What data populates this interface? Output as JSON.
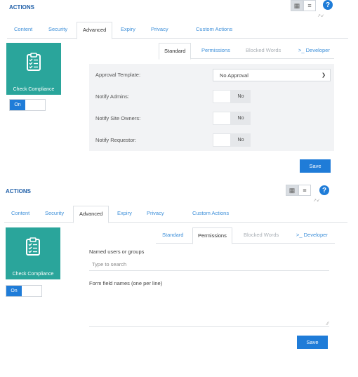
{
  "panels": [
    {
      "title": "ACTIONS",
      "top_tabs": [
        "Content",
        "Security",
        "Advanced",
        "Expiry",
        "Privacy",
        "Custom Actions"
      ],
      "active_top_tab": "Advanced",
      "compliance_label": "Check Compliance",
      "toggle_label": "On",
      "sub_tabs": [
        "Standard",
        "Permissions",
        "Blocked Words",
        ">_ Developer"
      ],
      "active_sub_tab": "Standard",
      "approval_template_label": "Approval Template:",
      "approval_template_value": "No Approval",
      "notify_admins_label": "Notify Admins:",
      "notify_admins_value": "No",
      "notify_site_owners_label": "Notify Site Owners:",
      "notify_site_owners_value": "No",
      "notify_requestor_label": "Notify Requestor:",
      "notify_requestor_value": "No",
      "save_label": "Save"
    },
    {
      "title": "ACTIONS",
      "top_tabs": [
        "Content",
        "Security",
        "Advanced",
        "Expiry",
        "Privacy",
        "Custom Actions"
      ],
      "active_top_tab": "Advanced",
      "compliance_label": "Check Compliance",
      "toggle_label": "On",
      "sub_tabs": [
        "Standard",
        "Permissions",
        "Blocked Words",
        ">_ Developer"
      ],
      "active_sub_tab": "Permissions",
      "named_users_label": "Named users or groups",
      "search_placeholder": "Type to search",
      "form_field_label": "Form field names (one per line)",
      "save_label": "Save"
    }
  ],
  "icons": {
    "grid": "grid-view-icon",
    "list": "list-view-icon",
    "help": "help-icon",
    "clipboard": "clipboard-check-icon",
    "chevron": "chevron-down-icon",
    "resize": "resize-grip-icon"
  },
  "colors": {
    "accent": "#1f7cd8",
    "title": "#1f5fa8",
    "tab_link": "#3d8fd9",
    "tile": "#2aa59b",
    "form_bg": "#f2f3f5"
  }
}
